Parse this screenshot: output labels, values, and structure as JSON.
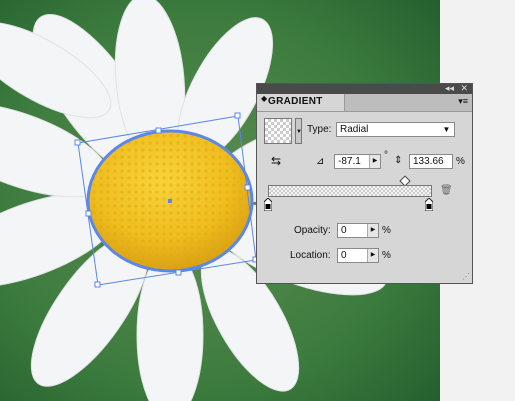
{
  "panel": {
    "title": "GRADIENT",
    "type_label": "Type:",
    "type_value": "Radial",
    "angle_value": "-87.1",
    "degree_sign": "°",
    "aspect_value": "133.66",
    "percent_sign": "%",
    "opacity_label": "Opacity:",
    "opacity_value": "0",
    "location_label": "Location:",
    "location_value": "0",
    "opacity_unit": "%",
    "location_unit": "%"
  },
  "icons": {
    "collapse": "◂◂",
    "close": "✕",
    "menu": "▾≡",
    "tab_arrows": "◆",
    "dropdown": "▼",
    "spin": "▶",
    "reverse": "⇆",
    "angle": "⊿",
    "aspect": "⇕",
    "trash": "🗑",
    "resize": "⋰"
  },
  "colors": {
    "selection": "#5b87e8",
    "flower_center": "#f2c21b",
    "background": "#2f6a33"
  }
}
